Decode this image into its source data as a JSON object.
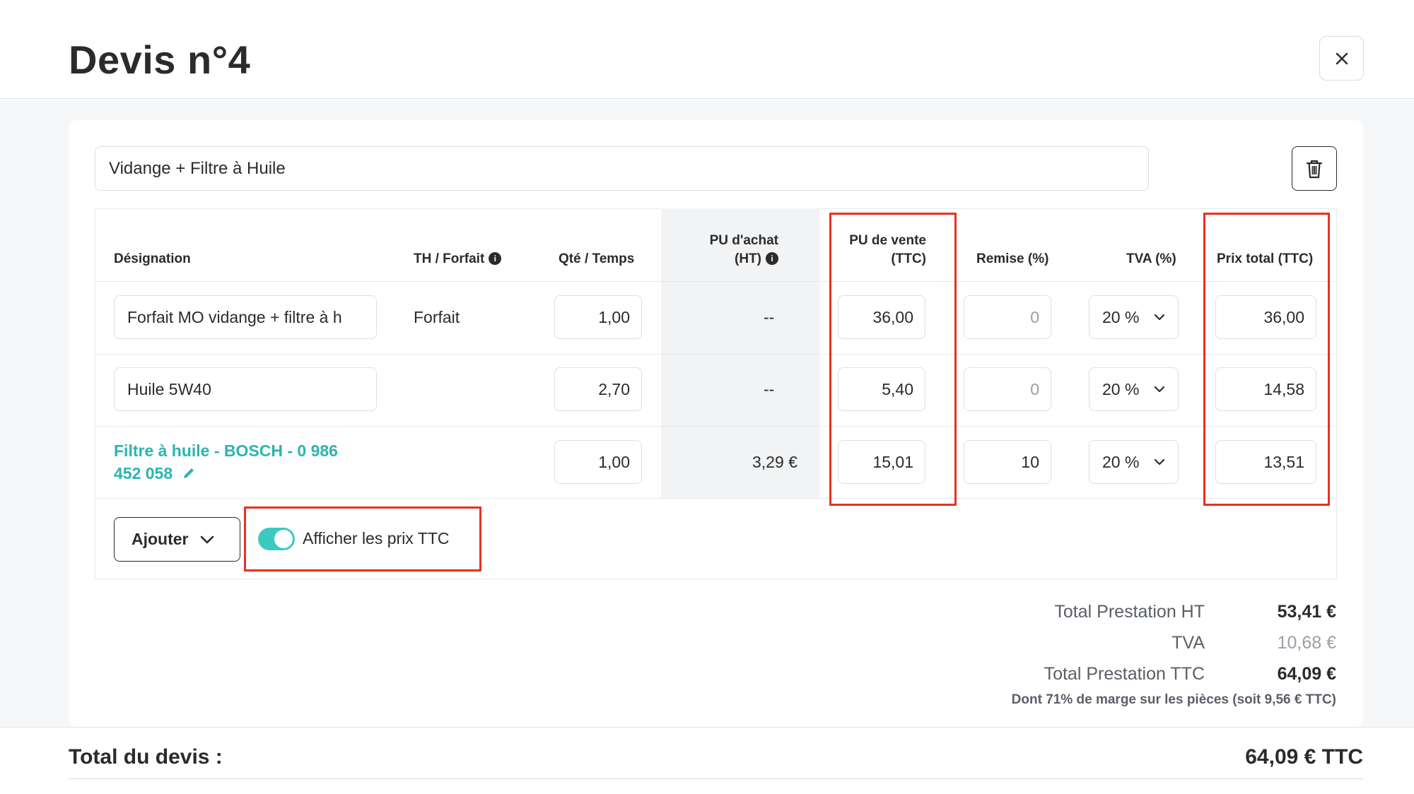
{
  "title": "Devis n°4",
  "service": {
    "name": "Vidange + Filtre à Huile"
  },
  "table": {
    "headers": {
      "designation": "Désignation",
      "th_forfait": "TH / Forfait",
      "qty_time": "Qté / Temps",
      "pu_achat_line1": "PU d'achat",
      "pu_achat_line2": "(HT)",
      "pu_vente_line1": "PU de vente",
      "pu_vente_line2": "(TTC)",
      "remise": "Remise (%)",
      "tva": "TVA (%)",
      "prix_total": "Prix total (TTC)"
    },
    "rows": [
      {
        "designation": "Forfait MO vidange + filtre à h",
        "th_forfait": "Forfait",
        "qty": "1,00",
        "pu_achat": "--",
        "pu_vente": "36,00",
        "remise": "0",
        "tva": "20 %",
        "prix_total": "36,00"
      },
      {
        "designation": "Huile 5W40",
        "th_forfait": "",
        "qty": "2,70",
        "pu_achat": "--",
        "pu_vente": "5,40",
        "remise": "0",
        "tva": "20 %",
        "prix_total": "14,58"
      },
      {
        "designation_line1": "Filtre à huile - BOSCH - 0 986",
        "designation_line2": "452 058",
        "qty": "1,00",
        "pu_achat": "3,29 €",
        "pu_vente": "15,01",
        "remise": "10",
        "tva": "20 %",
        "prix_total": "13,51"
      }
    ]
  },
  "actions": {
    "add_label": "Ajouter",
    "toggle_label": "Afficher les prix TTC",
    "toggle_on": true
  },
  "summary": {
    "total_ht_label": "Total Prestation HT",
    "total_ht_value": "53,41 €",
    "tva_label": "TVA",
    "tva_value": "10,68 €",
    "total_ttc_label": "Total Prestation TTC",
    "total_ttc_value": "64,09 €",
    "margin_note": "Dont 71% de marge sur les pièces (soit 9,56 € TTC)"
  },
  "footer": {
    "label": "Total du devis :",
    "value": "64,09 € TTC"
  },
  "colors": {
    "accent": "#2bb5b0",
    "highlight": "#e8321e",
    "toggle": "#3cc9c2"
  }
}
